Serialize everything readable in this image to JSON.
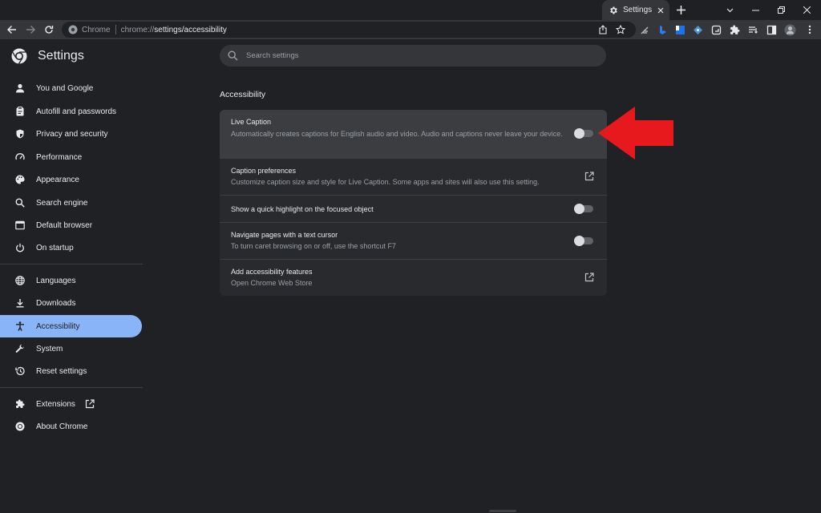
{
  "browser": {
    "tab": {
      "title": "Settings",
      "icon": "gear-icon"
    },
    "address": {
      "chip": "Chrome",
      "url_host": "chrome://",
      "url_rest": "settings/accessibility"
    },
    "colors": {
      "accent": "#8ab4f8",
      "background": "#202124",
      "card": "#292a2d",
      "arrow": "#e8191c"
    }
  },
  "header": {
    "title": "Settings",
    "search_placeholder": "Search settings"
  },
  "sidebar": {
    "items": [
      {
        "label": "You and Google",
        "icon": "person-icon"
      },
      {
        "label": "Autofill and passwords",
        "icon": "clipboard-icon"
      },
      {
        "label": "Privacy and security",
        "icon": "shield-icon"
      },
      {
        "label": "Performance",
        "icon": "speedometer-icon"
      },
      {
        "label": "Appearance",
        "icon": "palette-icon"
      },
      {
        "label": "Search engine",
        "icon": "search-icon"
      },
      {
        "label": "Default browser",
        "icon": "browser-window-icon"
      },
      {
        "label": "On startup",
        "icon": "power-icon"
      },
      {
        "label": "Languages",
        "icon": "globe-icon"
      },
      {
        "label": "Downloads",
        "icon": "download-icon"
      },
      {
        "label": "Accessibility",
        "icon": "accessibility-icon",
        "active": true
      },
      {
        "label": "System",
        "icon": "wrench-icon"
      },
      {
        "label": "Reset settings",
        "icon": "history-icon"
      },
      {
        "label": "Extensions",
        "icon": "puzzle-icon"
      },
      {
        "label": "About Chrome",
        "icon": "chrome-icon"
      }
    ]
  },
  "main": {
    "section_title": "Accessibility",
    "rows": [
      {
        "label": "Live Caption",
        "sub": "Automatically creates captions for English audio and video. Audio and captions never leave your device.",
        "control": "toggle",
        "on": false
      },
      {
        "label": "Caption preferences",
        "sub": "Customize caption size and style for Live Caption. Some apps and sites will also use this setting.",
        "control": "open-in-new-icon"
      },
      {
        "label": "Show a quick highlight on the focused object",
        "sub": "",
        "control": "toggle",
        "on": false
      },
      {
        "label": "Navigate pages with a text cursor",
        "sub": "To turn caret browsing on or off, use the shortcut F7",
        "control": "toggle",
        "on": false
      },
      {
        "label": "Add accessibility features",
        "sub": "Open Chrome Web Store",
        "control": "open-in-new-icon"
      }
    ]
  }
}
